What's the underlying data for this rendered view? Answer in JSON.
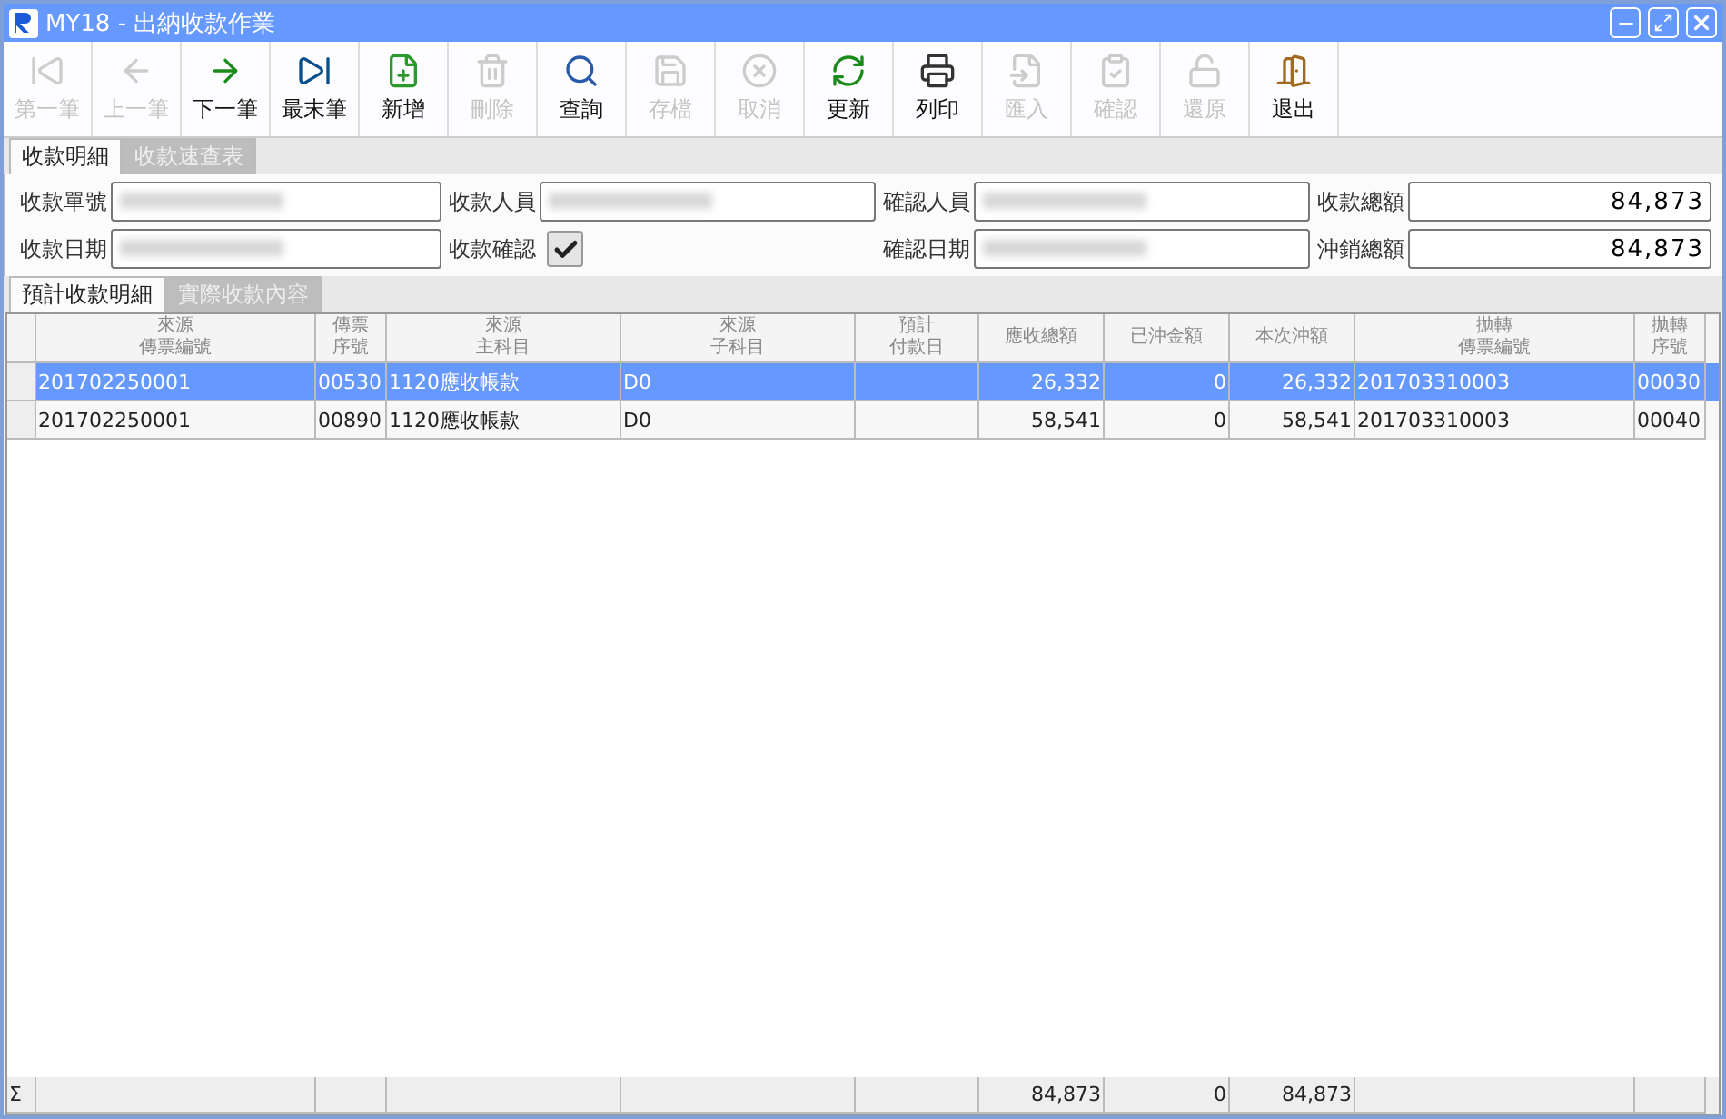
{
  "window": {
    "title": "MY18 - 出納收款作業"
  },
  "toolbar": [
    {
      "label": "第一筆",
      "disabled": true
    },
    {
      "label": "上一筆",
      "disabled": true
    },
    {
      "label": "下一筆",
      "disabled": false
    },
    {
      "label": "最末筆",
      "disabled": false
    },
    {
      "label": "新增",
      "disabled": false
    },
    {
      "label": "刪除",
      "disabled": true
    },
    {
      "label": "查詢",
      "disabled": false
    },
    {
      "label": "存檔",
      "disabled": true
    },
    {
      "label": "取消",
      "disabled": true
    },
    {
      "label": "更新",
      "disabled": false
    },
    {
      "label": "列印",
      "disabled": false
    },
    {
      "label": "匯入",
      "disabled": true
    },
    {
      "label": "確認",
      "disabled": true
    },
    {
      "label": "還原",
      "disabled": true
    },
    {
      "label": "退出",
      "disabled": false
    }
  ],
  "tabs": [
    {
      "label": "收款明細",
      "selected": true
    },
    {
      "label": "收款速查表",
      "selected": false
    }
  ],
  "form": [
    {
      "kind": "field",
      "label": "收款單號",
      "masked": true
    },
    {
      "kind": "field",
      "label": "收款人員",
      "masked": true
    },
    {
      "kind": "field",
      "label": "確認人員",
      "masked": true
    },
    {
      "kind": "field",
      "label": "收款總額",
      "value": "84,873"
    },
    {
      "kind": "field",
      "label": "收款日期",
      "masked": true
    },
    {
      "kind": "checkbox",
      "label": "收款確認",
      "checked": true
    },
    {
      "kind": "field",
      "label": "確認日期",
      "masked": true
    },
    {
      "kind": "field",
      "label": "沖銷總額",
      "value": "84,873"
    }
  ],
  "sub_tabs": [
    {
      "label": "預計收款明細",
      "selected": true
    },
    {
      "label": "實際收款內容",
      "selected": false
    }
  ],
  "table": {
    "columns": [
      {
        "label": "來源傳票編號",
        "stacked": true
      },
      {
        "label": "傳票序號",
        "stacked": true
      },
      {
        "label": "來源主科目",
        "stacked": true
      },
      {
        "label": "來源子科目",
        "stacked": true
      },
      {
        "label": "預計付款日",
        "stacked": true
      },
      {
        "label": "應收總額",
        "stacked": false
      },
      {
        "label": "已沖金額",
        "stacked": false
      },
      {
        "label": "本次沖額",
        "stacked": false
      },
      {
        "label": "拋轉傳票編號",
        "stacked": true
      },
      {
        "label": "拋轉序號",
        "stacked": true
      }
    ],
    "rows": [
      {
        "selected": true,
        "cells": [
          "201702250001",
          "00530",
          "1120應收帳款",
          "D0",
          "",
          "26,332",
          "0",
          "26,332",
          "201703310003",
          "00030"
        ]
      },
      {
        "selected": false,
        "cells": [
          "201702250001",
          "00890",
          "1120應收帳款",
          "D0",
          "",
          "58,541",
          "0",
          "58,541",
          "201703310003",
          "00040"
        ]
      }
    ],
    "footer": {
      "symbol": "Σ",
      "receivable_total": "84,873",
      "offset_total": "0",
      "current_offset_total": "84,873"
    }
  }
}
